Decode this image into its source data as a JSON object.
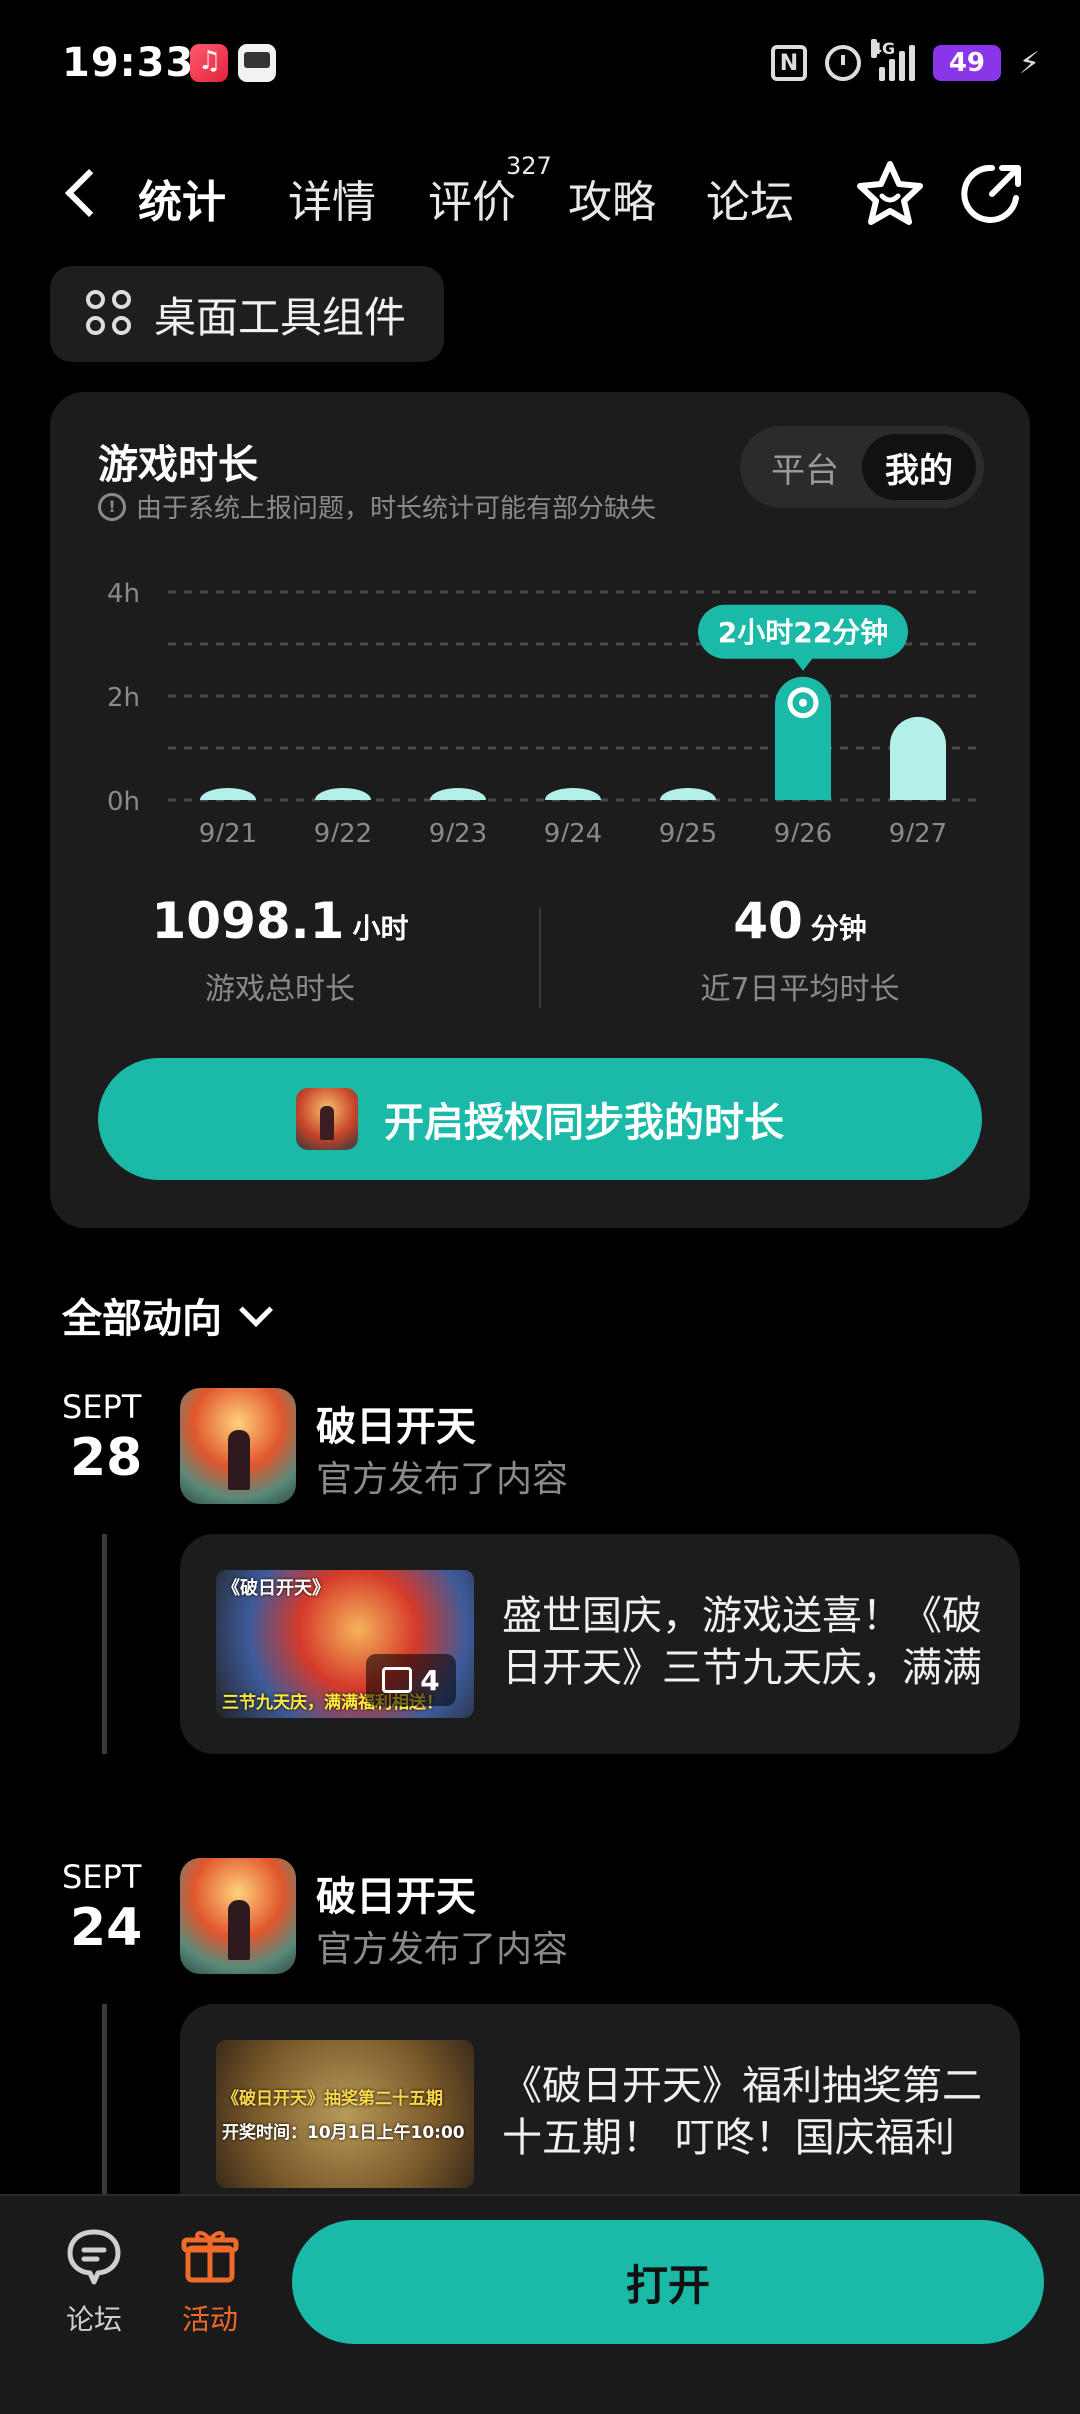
{
  "status_bar": {
    "time": "19:33",
    "network": "4G",
    "battery": "49",
    "icons": [
      "music-app-icon",
      "game-app-icon",
      "nfc-icon",
      "alarm-icon",
      "signal-icon",
      "battery-icon",
      "charging-icon"
    ]
  },
  "nav": {
    "tabs": [
      {
        "label": "统计",
        "active": true
      },
      {
        "label": "详情"
      },
      {
        "label": "评价",
        "count": "327"
      },
      {
        "label": "攻略"
      },
      {
        "label": "论坛"
      }
    ],
    "icons": [
      "back-icon",
      "star-icon",
      "share-icon"
    ]
  },
  "widget_button": {
    "label": "桌面工具组件",
    "icon": "widget-icon"
  },
  "stats_card": {
    "title": "游戏时长",
    "notice": "由于系统上报问题，时长统计可能有部分缺失",
    "toggle": {
      "options": [
        "平台",
        "我的"
      ],
      "selected": "我的"
    },
    "total_value": "1098.1",
    "total_unit": "小时",
    "total_label": "游戏总时长",
    "avg_value": "40",
    "avg_unit": "分钟",
    "avg_label": "近7日平均时长",
    "auth_button": "开启授权同步我的时长"
  },
  "chart_data": {
    "type": "bar",
    "categories": [
      "9/21",
      "9/22",
      "9/23",
      "9/24",
      "9/25",
      "9/26",
      "9/27"
    ],
    "values": [
      0.05,
      0.05,
      0.05,
      0.05,
      0.05,
      2.37,
      1.6
    ],
    "y_ticks": [
      "0h",
      "2h",
      "4h"
    ],
    "ylim": [
      0,
      4
    ],
    "grid": "dashed",
    "selected_index": 5,
    "tooltip": "2小时22分钟",
    "colors": {
      "bar": "#b3f0ea",
      "selected_bar": "#1bb9a8"
    }
  },
  "feed": {
    "title": "全部动向",
    "posts": [
      {
        "month": "SEPT",
        "day": "28",
        "author": "破日开天",
        "subtitle": "官方发布了内容",
        "text": "盛世国庆，游戏送喜！《破日开天》三节九天庆，满满福利相送！",
        "thumb_caption": "《破日开天》",
        "thumb_caption2": "三节九天庆，满满福利相送！",
        "image_count": "4"
      },
      {
        "month": "SEPT",
        "day": "24",
        "author": "破日开天",
        "subtitle": "官方发布了内容",
        "text": "《破日开天》福利抽奖第二十五期！ 叮咚！国庆福利来袭！",
        "thumb_caption": "《破日开天》抽奖第二十五期",
        "thumb_caption2": "开奖时间：10月1日上午10:00"
      }
    ]
  },
  "bottom_bar": {
    "forum_label": "论坛",
    "activity_label": "活动",
    "open_label": "打开"
  },
  "colors": {
    "accent": "#1bb9a8",
    "activity": "#f06a2a",
    "background": "#000000",
    "card": "#1c1c1c"
  }
}
